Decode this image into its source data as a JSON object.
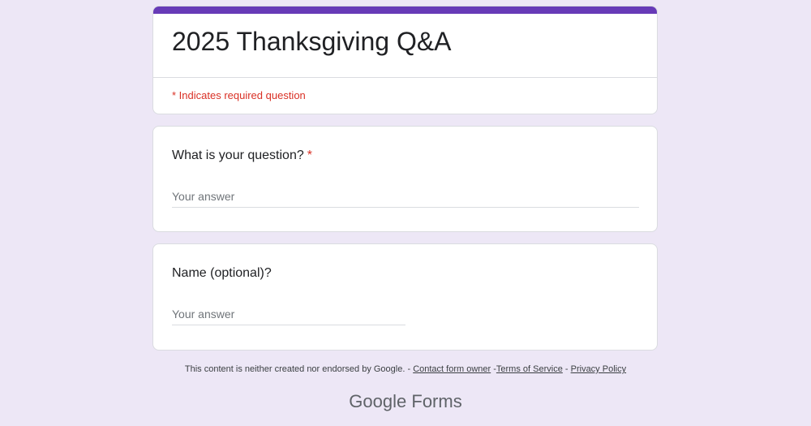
{
  "form": {
    "title": "2025 Thanksgiving Q&A",
    "required_note": "* Indicates required question",
    "accent_color": "#673ab7"
  },
  "questions": [
    {
      "label": "What is your question?",
      "required_marker": "*",
      "placeholder": "Your answer",
      "required": true
    },
    {
      "label": "Name (optional)?",
      "placeholder": "Your answer",
      "required": false
    }
  ],
  "footer": {
    "disclaimer": "This content is neither created nor endorsed by Google. -",
    "contact_link": "Contact form owner",
    "sep1": "-",
    "terms_link": "Terms of Service",
    "sep2": "-",
    "privacy_link": "Privacy Policy"
  },
  "brand": {
    "google": "Google",
    "product": "Forms"
  }
}
